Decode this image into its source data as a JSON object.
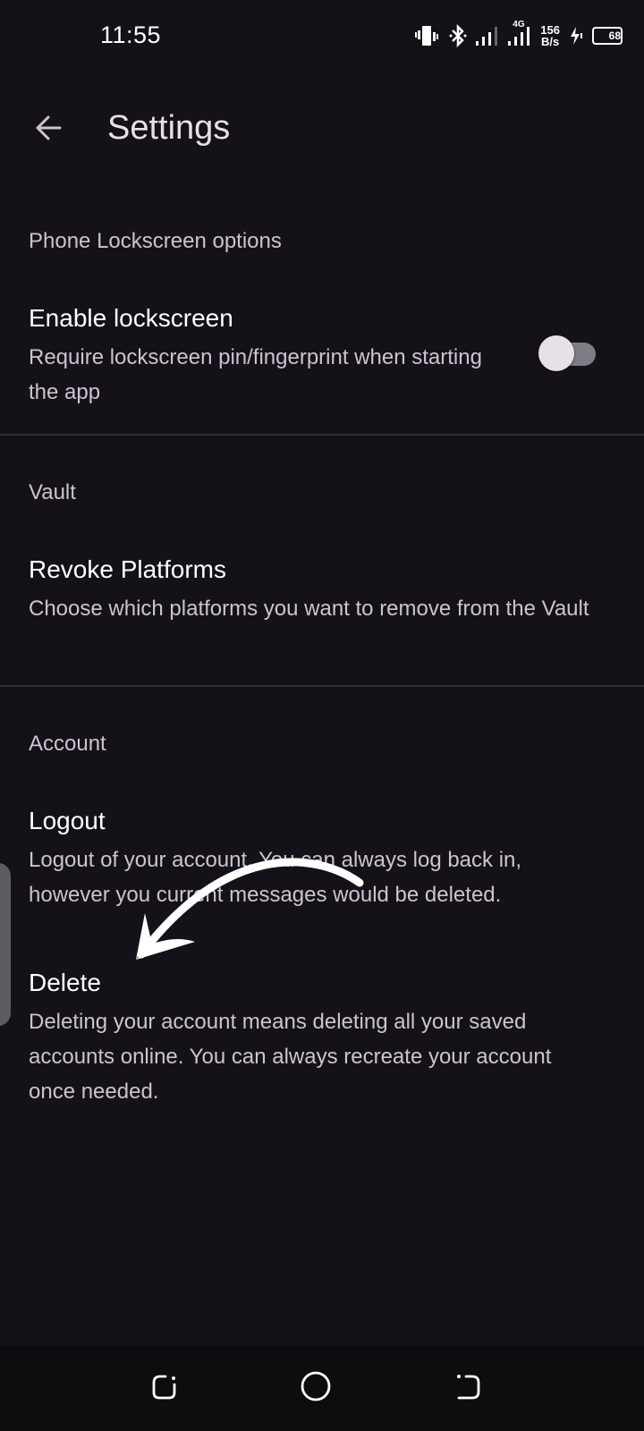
{
  "status_bar": {
    "time": "11:55",
    "icons": [
      "vibrate-icon",
      "bluetooth-icon",
      "signal-icon",
      "signal-4g-icon",
      "charging-icon",
      "battery-icon"
    ],
    "network_type": "4G",
    "net_speed_value": "156",
    "net_speed_unit": "B/s",
    "battery_level": "68"
  },
  "app_bar": {
    "back_icon": "arrow-left-icon",
    "title": "Settings"
  },
  "sections": [
    {
      "header": "Phone Lockscreen options",
      "items": [
        {
          "title": "Enable lockscreen",
          "summary": "Require lockscreen pin/fingerprint when starting the app",
          "toggle": {
            "on": false
          }
        }
      ]
    },
    {
      "header": "Vault",
      "items": [
        {
          "title": "Revoke Platforms",
          "summary": "Choose which platforms you want to remove from the Vault"
        }
      ]
    },
    {
      "header": "Account",
      "items": [
        {
          "title": "Logout",
          "summary": "Logout of your account. You can always log back in, however you current messages would be deleted."
        },
        {
          "title": "Delete",
          "summary": "Deleting your account means deleting all your saved accounts online. You can always recreate your account once needed."
        }
      ]
    }
  ],
  "annotation": {
    "icon": "curved-arrow-icon",
    "color": "#FFFFFF"
  },
  "nav_bar": {
    "buttons": [
      "recents-icon",
      "home-icon",
      "back-icon"
    ]
  },
  "colors": {
    "background": "#141218",
    "title_text": "#FFFFFF",
    "secondary_text": "#CAC4D0",
    "divider": "#322F37",
    "nav_background": "#0D0D0F"
  }
}
